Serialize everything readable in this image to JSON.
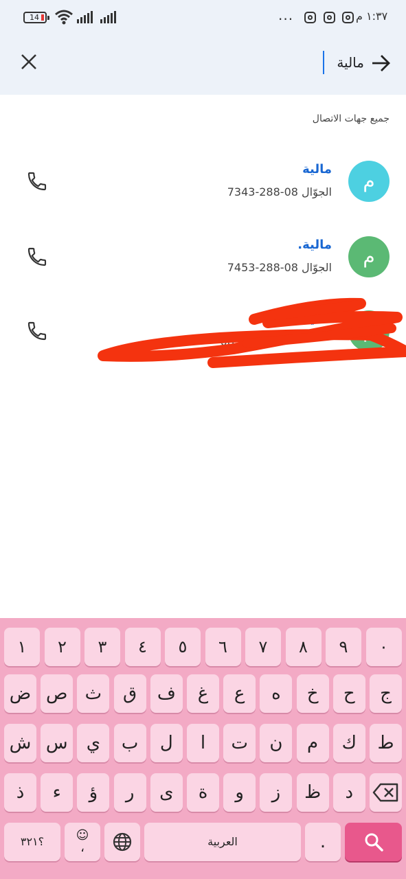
{
  "status": {
    "time": "١:٣٧ م",
    "battery": "14",
    "more": "..."
  },
  "search": {
    "query": "مالية"
  },
  "section_header": "جميع جهات الاتصال",
  "contacts": [
    {
      "initial": "م",
      "name": "مالية",
      "phone": "الجوّال 08-288-7343",
      "color": "#4dd0e1"
    },
    {
      "initial": "م",
      "name": "مالية.",
      "phone": "الجوّال 08-288-7453",
      "color": "#5bb974"
    },
    {
      "initial": "م",
      "name": "مالية",
      "phone": "08",
      "color": "#5bb974"
    }
  ],
  "keyboard": {
    "row1": [
      "١",
      "٢",
      "٣",
      "٤",
      "٥",
      "٦",
      "٧",
      "٨",
      "٩",
      "٠"
    ],
    "row2": [
      "ض",
      "ص",
      "ث",
      "ق",
      "ف",
      "غ",
      "ع",
      "ه",
      "خ",
      "ح",
      "ج"
    ],
    "row3": [
      "ش",
      "س",
      "ي",
      "ب",
      "ل",
      "ا",
      "ت",
      "ن",
      "م",
      "ك",
      "ط"
    ],
    "row4": [
      "ذ",
      "ء",
      "ؤ",
      "ر",
      "ى",
      "ة",
      "و",
      "ز",
      "ظ",
      "د"
    ],
    "symbols": "؟٣٢١",
    "emoji_key": "☺",
    "comma": "،",
    "space": "العربية",
    "period": "."
  }
}
